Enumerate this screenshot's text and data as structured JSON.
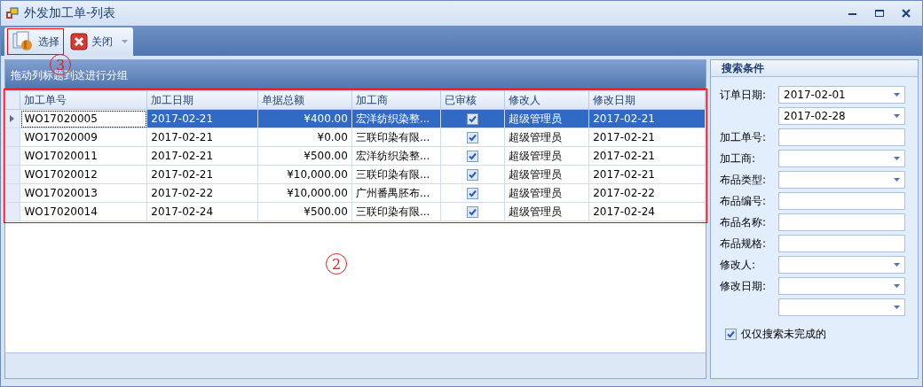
{
  "window": {
    "title": "外发加工单-列表"
  },
  "toolbar": [
    {
      "kind": "select",
      "label": "选择",
      "highlighted": true
    },
    {
      "kind": "close",
      "label": "关闭"
    }
  ],
  "group_panel": {
    "hint": "拖动列标题到这进行分组"
  },
  "table": {
    "highlighted": true,
    "columns": [
      "加工单号",
      "加工日期",
      "单据总额",
      "加工商",
      "已审核",
      "修改人",
      "修改日期"
    ],
    "rows": [
      {
        "selected": true,
        "cells": [
          "WO17020005",
          "2017-02-21",
          "¥400.00",
          "宏洋纺织染整...",
          "",
          "超级管理员",
          "2017-02-21"
        ],
        "checked": true
      },
      {
        "selected": false,
        "cells": [
          "WO17020009",
          "2017-02-21",
          "¥0.00",
          "三联印染有限...",
          "",
          "超级管理员",
          "2017-02-21"
        ],
        "checked": true
      },
      {
        "selected": false,
        "cells": [
          "WO17020011",
          "2017-02-21",
          "¥500.00",
          "宏洋纺织染整...",
          "",
          "超级管理员",
          "2017-02-21"
        ],
        "checked": true
      },
      {
        "selected": false,
        "cells": [
          "WO17020012",
          "2017-02-21",
          "¥10,000.00",
          "三联印染有限...",
          "",
          "超级管理员",
          "2017-02-21"
        ],
        "checked": true
      },
      {
        "selected": false,
        "cells": [
          "WO17020013",
          "2017-02-22",
          "¥10,000.00",
          "广州番禺胚布...",
          "",
          "超级管理员",
          "2017-02-22"
        ],
        "checked": true
      },
      {
        "selected": false,
        "cells": [
          "WO17020014",
          "2017-02-24",
          "¥500.00",
          "三联印染有限...",
          "",
          "超级管理员",
          "2017-02-24"
        ],
        "checked": true
      }
    ]
  },
  "search": {
    "title": "搜索条件",
    "fields": [
      {
        "label": "订单日期:",
        "kind": "dropdown",
        "value": "2017-02-01"
      },
      {
        "kind": "dropdown",
        "value": "2017-02-28"
      },
      {
        "label": "加工单号:",
        "kind": "text"
      },
      {
        "label": "加工商:",
        "kind": "dropdown"
      },
      {
        "label": "布品类型:",
        "kind": "dropdown"
      },
      {
        "label": "布品编号:",
        "kind": "text"
      },
      {
        "label": "布品名称:",
        "kind": "text"
      },
      {
        "label": "布品规格:",
        "kind": "text"
      },
      {
        "label": "修改人:",
        "kind": "dropdown"
      },
      {
        "label": "修改日期:",
        "kind": "dropdown"
      },
      {
        "kind": "dropdown"
      }
    ],
    "only_unfinished": {
      "label": "仅仅搜索未完成的",
      "checked": true
    }
  },
  "annotations": [
    {
      "kind": "circle",
      "label": "3"
    },
    {
      "kind": "circle",
      "label": "2"
    }
  ]
}
